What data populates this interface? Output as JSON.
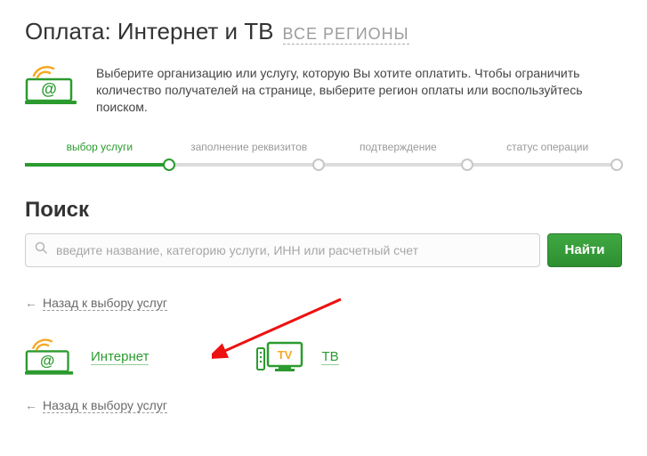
{
  "title": {
    "main": "Оплата: Интернет и ТВ",
    "region": "ВСЕ РЕГИОНЫ"
  },
  "intro": "Выберите организацию или услугу, которую Вы хотите оплатить. Чтобы ограничить количество получателей на странице, выберите регион оплаты или воспользуйтесь поиском.",
  "wizard": {
    "step1": "выбор услуги",
    "step2": "заполнение реквизитов",
    "step3": "подтверждение",
    "step4": "статус операции"
  },
  "search": {
    "heading": "Поиск",
    "placeholder": "введите название, категорию услуги, ИНН или расчетный счет",
    "button": "Найти"
  },
  "back": {
    "arrow": "←",
    "label": "Назад к выбору услуг"
  },
  "categories": {
    "internet": "Интернет",
    "tv": "ТВ"
  }
}
